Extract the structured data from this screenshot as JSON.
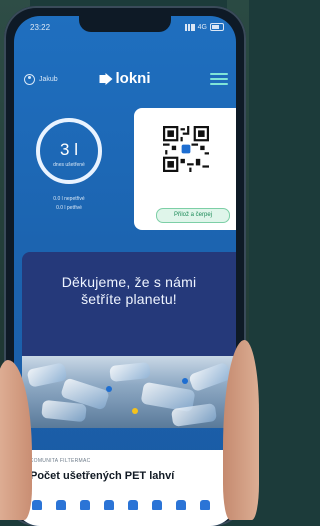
{
  "status_bar": {
    "time": "23:22",
    "network": "4G"
  },
  "nav": {
    "user_name": "Jakub",
    "logo_text": "lokni"
  },
  "counter": {
    "value": "3 l",
    "unit_label": "dnes ušetřené",
    "line1": "0.0 l nepetřivé",
    "line2": "0.0 l petřivé"
  },
  "qr_card": {
    "button_label": "Přilož a čerpej"
  },
  "banner": {
    "title_line1": "Děkujeme, že s námi",
    "title_line2": "šetříte planetu!"
  },
  "stats": {
    "community_label": "KOMUNITA FILTERMAC",
    "title": "Počet ušetřených PET lahví"
  },
  "colors": {
    "primary_blue": "#1f6fbf",
    "banner_navy": "#25397a",
    "accent_green": "#7dcfa6",
    "menu_teal": "#7fe5d8"
  }
}
